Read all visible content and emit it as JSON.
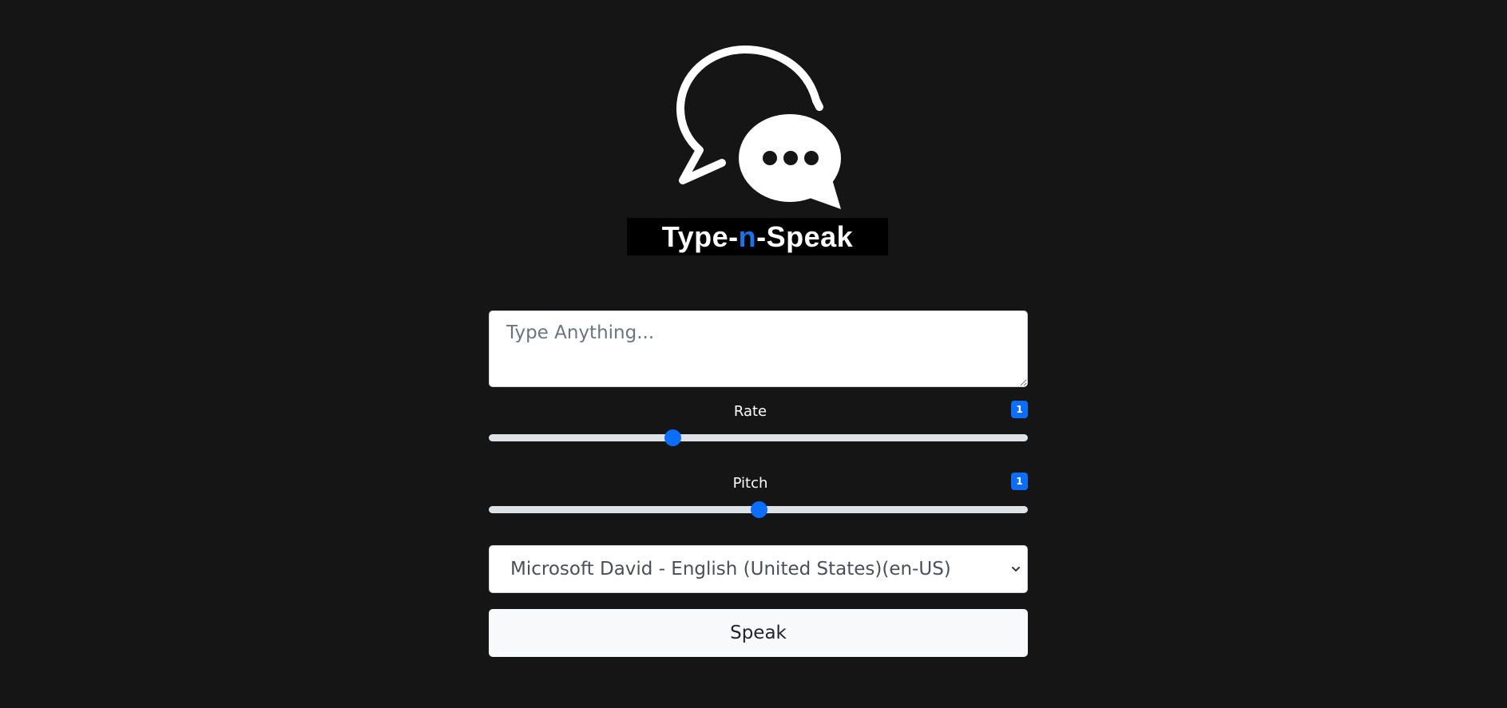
{
  "logo": {
    "icon": "speech-bubbles-icon",
    "title_part1": "Type-",
    "title_accent": "n",
    "title_part2": "-Speak",
    "accent_color": "#1a73e8"
  },
  "form": {
    "text_placeholder": "Type Anything...",
    "text_value": "",
    "rate": {
      "label": "Rate",
      "value": "1",
      "position": 0.34
    },
    "pitch": {
      "label": "Pitch",
      "value": "1",
      "position": 0.5
    },
    "voice": {
      "selected": "Microsoft David - English (United States)(en-US)"
    },
    "speak_label": "Speak"
  },
  "colors": {
    "background": "#151515",
    "primary": "#0d6efd",
    "button": "#f8f9fa"
  }
}
